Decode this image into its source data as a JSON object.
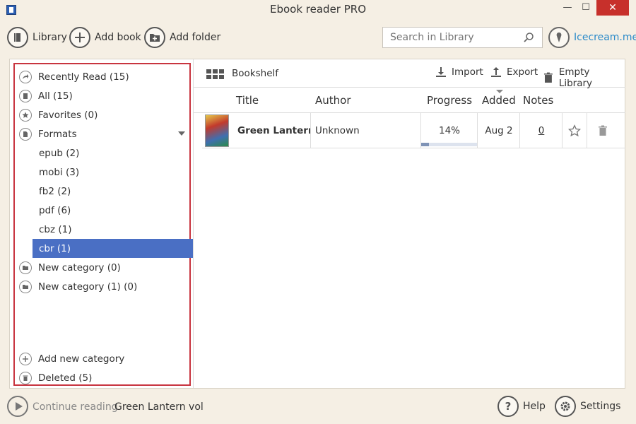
{
  "window": {
    "title": "Ebook reader PRO",
    "minimize": "—",
    "maximize": "☐",
    "close": "✕"
  },
  "toolbar": {
    "library": "Library",
    "add_book": "Add book",
    "add_folder": "Add folder",
    "search_placeholder": "Search in Library",
    "brand": "Icecream.me"
  },
  "sidebar": {
    "items": [
      {
        "label": "Recently Read (15)",
        "icon": "share-icon"
      },
      {
        "label": "All (15)",
        "icon": "book-stack-icon"
      },
      {
        "label": "Favorites (0)",
        "icon": "star-icon"
      },
      {
        "label": "Formats",
        "icon": "document-icon"
      }
    ],
    "formats": [
      "epub (2)",
      "mobi (3)",
      "fb2 (2)",
      "pdf (6)",
      "cbz (1)",
      "cbr (1)"
    ],
    "active_format": "cbr (1)",
    "categories": [
      "New category (0)",
      "New category (1) (0)"
    ],
    "add_category": "Add new category",
    "deleted": "Deleted (5)"
  },
  "content": {
    "view_label": "Bookshelf",
    "import": "Import",
    "export": "Export",
    "empty": "Empty Library",
    "columns": {
      "title": "Title",
      "author": "Author",
      "progress": "Progress",
      "added": "Added",
      "notes": "Notes"
    },
    "rows": [
      {
        "title": "Green Lantern v",
        "author": "Unknown",
        "progress_text": "14%",
        "progress": 0.14,
        "added": "Aug 2",
        "notes": "0"
      }
    ]
  },
  "bottom": {
    "continue_label": "Continue reading",
    "continue_book": "Green Lantern vol",
    "help": "Help",
    "settings": "Settings"
  },
  "colors": {
    "accent": "#4a6fc4",
    "brand": "#2a8ac9",
    "highlight_border": "#c8343f",
    "close": "#c7302b"
  }
}
